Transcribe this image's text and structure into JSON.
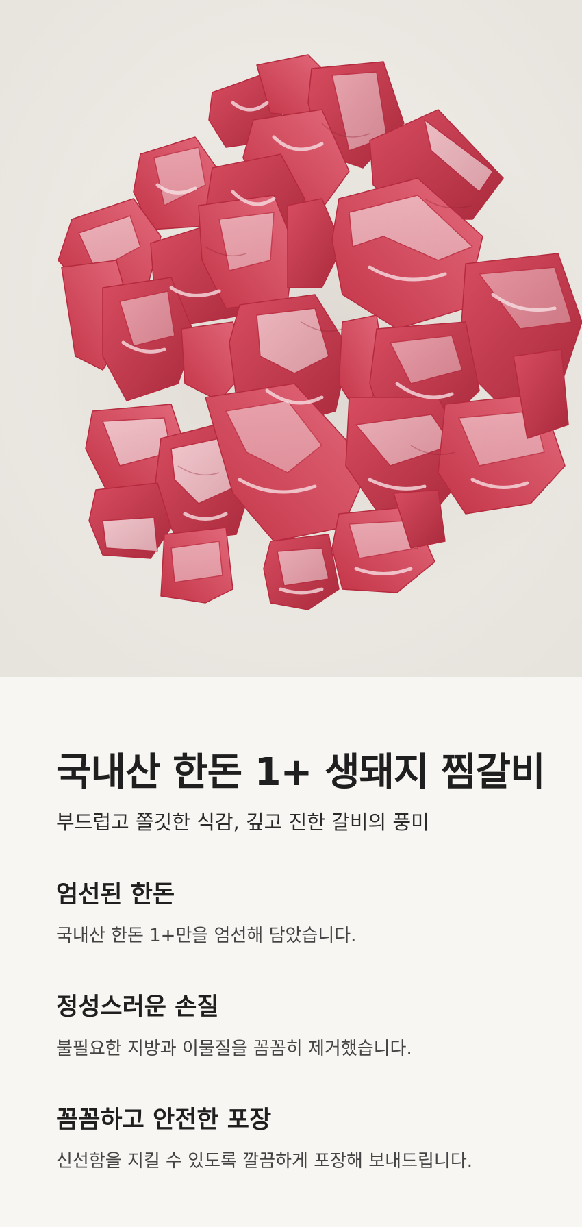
{
  "product": {
    "title": "국내산 한돈 1+ 생돼지 찜갈비",
    "subtitle": "부드럽고 쫄깃한 식감, 깊고 진한 갈비의 풍미"
  },
  "features": [
    {
      "title": "엄선된 한돈",
      "description": "국내산 한돈 1+만을 엄선해 담았습니다."
    },
    {
      "title": "정성스러운 손질",
      "description": "불필요한 지방과 이물질을 꼼꼼히 제거했습니다."
    },
    {
      "title": "꼼꼼하고 안전한 포장",
      "description": "신선함을 지킬 수 있도록 깔끔하게 포장해 보내드립니다."
    }
  ],
  "colors": {
    "hero_background": "#ede9e3",
    "page_background": "#f8f6f2",
    "meat_red": "#c9354a",
    "fat_white": "#f2e4e6"
  }
}
